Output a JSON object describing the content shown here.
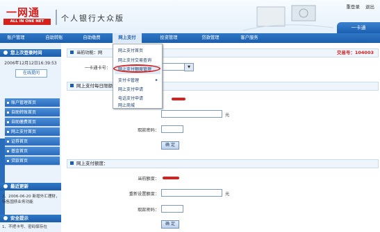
{
  "header": {
    "logo_cn": "一网通",
    "logo_en": "ALL IN ONE NET",
    "site_title": "个人银行大众版",
    "links": [
      "重登录",
      "退出"
    ],
    "card_tab": "一卡通"
  },
  "nav": {
    "items": [
      "账户管理",
      "自助转账",
      "自助缴费",
      "网上支付",
      "投资管理",
      "贷款管理",
      "客户服务"
    ]
  },
  "sidebar": {
    "last_login_title": "您上次登录时间",
    "last_login_time": "2006年12月12日16:39:53",
    "online_button": "在线提问",
    "menu": [
      "账户管理首页",
      "自助转账首页",
      "自助缴费首页",
      "网上支付首页",
      "证券首页",
      "基金首页",
      "贷款首页"
    ],
    "news_title": "最近更新",
    "news_text": "2、2006-06-20 新增外汇理财，待售国债业务功能",
    "safety_title": "安全提示",
    "safety_text": "1、不把卡号、密码保存在"
  },
  "main": {
    "breadcrumb_label": "当前功能：",
    "breadcrumb_value": "网",
    "trade_code": "交易号：104003",
    "card_label": "一卡通卡号：",
    "section1_title": "网上支付每日限额",
    "yuan1": "元",
    "pwd_label1": "取款密码：",
    "confirm1": "确 定",
    "section2_title": "网上支付额度：",
    "current_label": "当前额度：",
    "reset_label": "重新设置额度：",
    "yuan2": "元",
    "pwd_label2": "取款密码：",
    "confirm2": "确 定"
  },
  "dropdown": {
    "items": [
      "网上支付首页",
      "网上支付交易查询",
      "网上支付额度管理",
      "支付卡管理",
      "网上支付申请",
      "电话支付申请",
      "网上商城"
    ],
    "highlighted_index": 2
  },
  "colors": {
    "brand_red": "#d6201b",
    "nav_blue": "#1c5eaa"
  }
}
